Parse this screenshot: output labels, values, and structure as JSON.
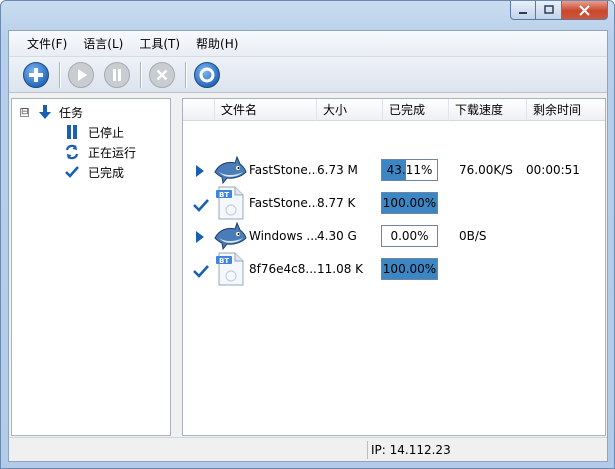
{
  "menu": [
    {
      "label": "文件(F)"
    },
    {
      "label": "语言(L)"
    },
    {
      "label": "工具(T)"
    },
    {
      "label": "帮助(H)"
    }
  ],
  "toolbar": {
    "add_icon": "plus-circle-icon",
    "start_icon": "play-icon",
    "pause_icon": "pause-icon",
    "delete_icon": "close-circle-icon",
    "settings_icon": "ring-icon"
  },
  "tree": {
    "root": {
      "label": "任务",
      "expander": "⊟"
    },
    "children": [
      {
        "label": "已停止"
      },
      {
        "label": "正在运行"
      },
      {
        "label": "已完成"
      }
    ]
  },
  "table": {
    "columns": [
      "文件名",
      "大小",
      "已完成",
      "下载速度",
      "剩余时间"
    ],
    "rows": [
      {
        "status_icon": "play-triangle-icon",
        "file_icon": "shark-icon",
        "name": "FastStone...",
        "size": "6.73 M",
        "progress": 43.11,
        "progress_text": "43.11%",
        "speed": "76.00K/S",
        "remaining": "00:00:51"
      },
      {
        "status_icon": "check-icon",
        "file_icon": "bt-file-icon",
        "name": "FastStone...",
        "size": "8.77 K",
        "progress": 100,
        "progress_text": "100.00%",
        "speed": "",
        "remaining": ""
      },
      {
        "status_icon": "play-triangle-icon",
        "file_icon": "shark-icon",
        "name": "Windows ...",
        "size": "4.30 G",
        "progress": 0,
        "progress_text": "0.00%",
        "speed": "0B/S",
        "remaining": ""
      },
      {
        "status_icon": "check-icon",
        "file_icon": "bt-file-icon",
        "name": "8f76e4c8...",
        "size": "11.08 K",
        "progress": 100,
        "progress_text": "100.00%",
        "speed": "",
        "remaining": ""
      }
    ]
  },
  "status": {
    "ip": "IP: 14.112.23"
  },
  "colors": {
    "accent": "#1a5fb4",
    "progress_fill": "#3d86c4"
  }
}
